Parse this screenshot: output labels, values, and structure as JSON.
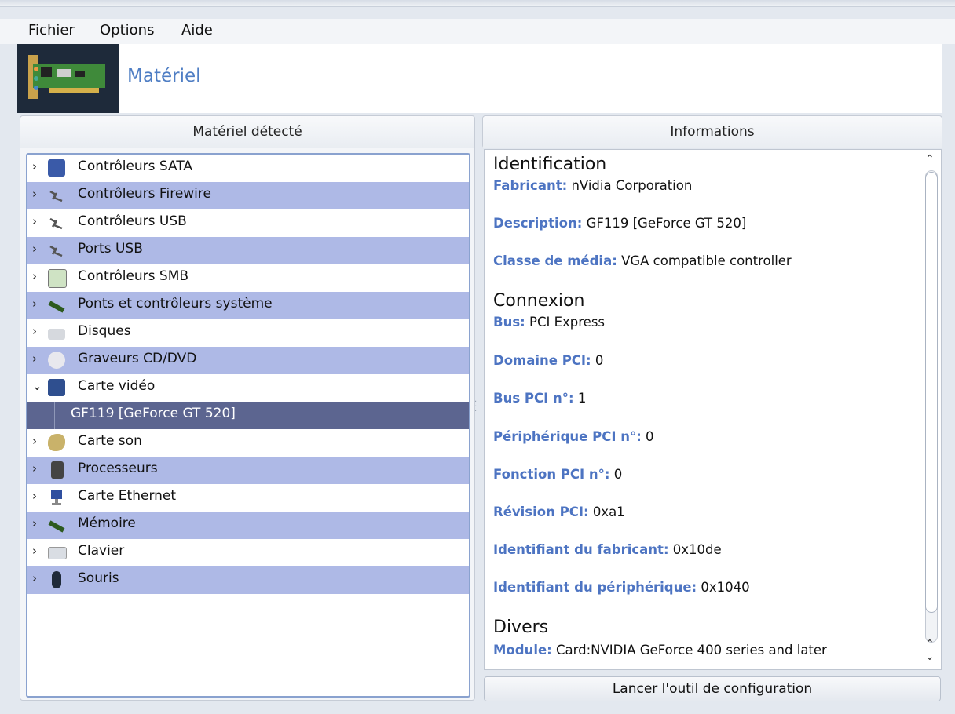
{
  "menubar": {
    "items": [
      {
        "label": "Fichier"
      },
      {
        "label": "Options"
      },
      {
        "label": "Aide"
      }
    ]
  },
  "header": {
    "title": "Matériel",
    "icon": "pci-card-icon"
  },
  "left_panel": {
    "title": "Matériel détecté",
    "items": [
      {
        "label": "Contrôleurs SATA",
        "icon": "sata-controller-icon",
        "expanded": false
      },
      {
        "label": "Contrôleurs Firewire",
        "icon": "firewire-plug-icon",
        "expanded": false
      },
      {
        "label": "Contrôleurs USB",
        "icon": "usb-plug-icon",
        "expanded": false
      },
      {
        "label": "Ports USB",
        "icon": "usb-plug-icon",
        "expanded": false
      },
      {
        "label": "Contrôleurs SMB",
        "icon": "smb-controller-icon",
        "expanded": false
      },
      {
        "label": "Ponts et contrôleurs système",
        "icon": "memory-stick-icon",
        "expanded": false
      },
      {
        "label": "Disques",
        "icon": "disk-icon",
        "expanded": false
      },
      {
        "label": "Graveurs CD/DVD",
        "icon": "cd-dvd-icon",
        "expanded": false
      },
      {
        "label": "Carte vidéo",
        "icon": "video-card-icon",
        "expanded": true
      },
      {
        "label": "GF119 [GeForce GT 520]",
        "child": true,
        "selected": true
      },
      {
        "label": "Carte son",
        "icon": "sound-card-icon",
        "expanded": false
      },
      {
        "label": "Processeurs",
        "icon": "processor-icon",
        "expanded": false
      },
      {
        "label": "Carte Ethernet",
        "icon": "ethernet-icon",
        "expanded": false
      },
      {
        "label": "Mémoire",
        "icon": "memory-stick-icon",
        "expanded": false
      },
      {
        "label": "Clavier",
        "icon": "keyboard-icon",
        "expanded": false
      },
      {
        "label": "Souris",
        "icon": "mouse-icon",
        "expanded": false
      }
    ]
  },
  "right_panel": {
    "title": "Informations",
    "sections": {
      "identification": {
        "heading": "Identification",
        "fields": [
          {
            "key": "Fabricant:",
            "value": "nVidia Corporation"
          },
          {
            "key": "Description:",
            "value": "GF119 [GeForce GT 520]"
          },
          {
            "key": "Classe de média:",
            "value": "VGA compatible controller"
          }
        ]
      },
      "connexion": {
        "heading": "Connexion",
        "fields": [
          {
            "key": "Bus:",
            "value": "PCI Express"
          },
          {
            "key": "Domaine PCI:",
            "value": "0"
          },
          {
            "key": "Bus PCI n°:",
            "value": "1"
          },
          {
            "key": "Périphérique PCI n°:",
            "value": "0"
          },
          {
            "key": "Fonction PCI n°:",
            "value": "0"
          },
          {
            "key": "Révision PCI:",
            "value": "0xa1"
          },
          {
            "key": "Identifiant du fabricant:",
            "value": "0x10de"
          },
          {
            "key": "Identifiant du périphérique:",
            "value": "0x1040"
          }
        ]
      },
      "divers": {
        "heading": "Divers",
        "fields": [
          {
            "key": "Module:",
            "value": "Card:NVIDIA GeForce 400 series and later"
          }
        ]
      }
    }
  },
  "button": {
    "label": "Lancer l'outil de configuration"
  },
  "colors": {
    "accent": "#4d74c2",
    "row_alt": "#aeb9e6",
    "row_selected": "#5c6590"
  }
}
